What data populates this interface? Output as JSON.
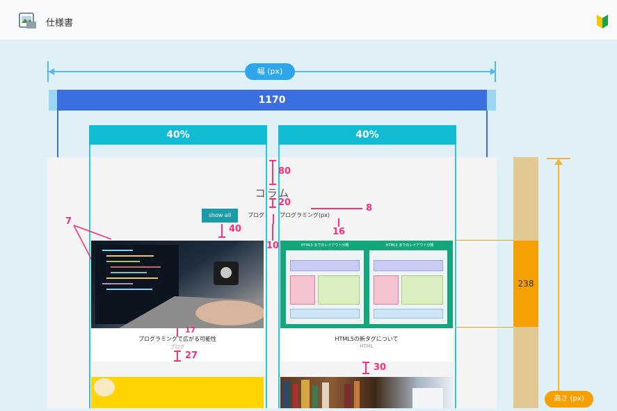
{
  "app": {
    "title": "仕様書",
    "doc_icon": "document-image-icon",
    "badge_icon": "beginner-mark-icon"
  },
  "width_pill": "幅 (px)",
  "container_width": "1170",
  "columns": [
    "40%",
    "40%"
  ],
  "page": {
    "heading": "コラム",
    "filters": [
      "show all",
      "ブログ",
      "プログラミング"
    ],
    "filters_extra": "(px)",
    "cards": [
      {
        "title": "プログラミングで広がる可能性",
        "sub": "ブログ"
      },
      {
        "title": "HTML5の新タグについて",
        "sub": "HTML"
      }
    ],
    "thumb_labels": [
      "HTML5 までのレイアウト分類",
      "HTML5 までのレイアウト分類"
    ]
  },
  "measures": {
    "m80": "80",
    "m20": "20",
    "m8": "8",
    "m40": "40",
    "m16": "16",
    "m10": "10",
    "m7": "7",
    "m17": "17",
    "m27": "27",
    "m30": "30"
  },
  "height_value": "238",
  "height_pill": "高さ (px)",
  "colors": {
    "blue_bar": "#3b6fe0",
    "cyan": "#10bcd3",
    "pink": "#ff2f7b",
    "orange": "#f5a000",
    "tan": "#e2c893",
    "teal_button": "#1b9aa8"
  }
}
